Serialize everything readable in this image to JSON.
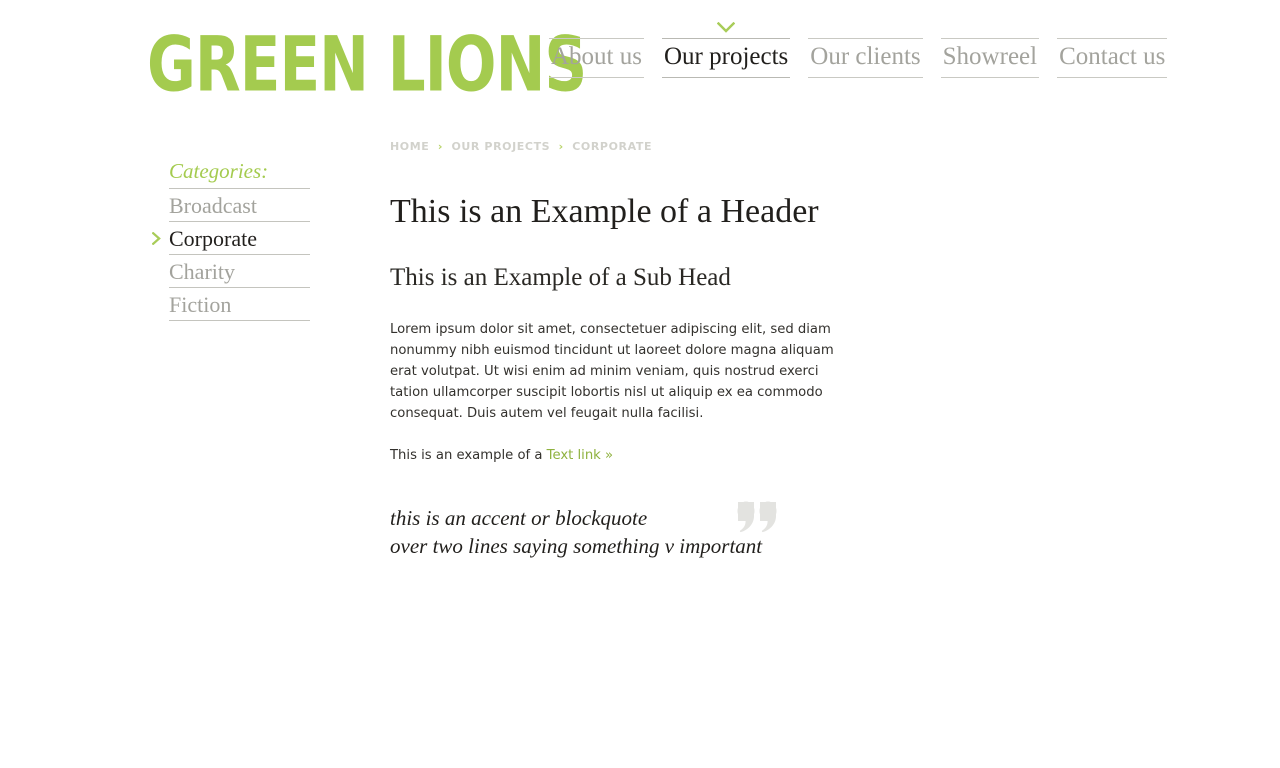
{
  "site": {
    "logo_text": "GREEN LIONS",
    "brand_green": "#a4cb4f",
    "link_green": "#8fb23f",
    "muted_gray": "#a3a39d",
    "text_dark": "#211f1c"
  },
  "nav": {
    "items": [
      {
        "label": "About us",
        "active": false
      },
      {
        "label": "Our projects",
        "active": true
      },
      {
        "label": "Our clients",
        "active": false
      },
      {
        "label": "Showreel",
        "active": false
      },
      {
        "label": "Contact us",
        "active": false
      }
    ],
    "marker_icon": "chevron-down-icon"
  },
  "sidebar": {
    "title": "Categories:",
    "items": [
      {
        "label": "Broadcast",
        "active": false
      },
      {
        "label": "Corporate",
        "active": true
      },
      {
        "label": "Charity",
        "active": false
      },
      {
        "label": "Fiction",
        "active": false
      }
    ],
    "active_marker_icon": "chevron-right-icon"
  },
  "breadcrumb": {
    "separator": "›",
    "items": [
      {
        "label": "HOME",
        "current": false
      },
      {
        "label": "OUR PROJECTS",
        "current": false
      },
      {
        "label": "CORPORATE",
        "current": true
      }
    ]
  },
  "main": {
    "title": "This is an Example of a Header",
    "sub_head": "This is an Example of a Sub Head",
    "body": "Lorem ipsum dolor sit amet, consectetuer adipiscing elit, sed diam nonummy nibh euismod tincidunt ut laoreet dolore magna aliquam erat volutpat. Ut wisi enim ad minim veniam, quis nostrud exerci tation ullamcorper suscipit lobortis nisl ut aliquip ex ea commodo consequat. Duis autem vel feugait nulla facilisi.",
    "link_lead": "This is an example of a ",
    "link_label": "Text link »",
    "blockquote": {
      "line1": "this is an accent or blockquote",
      "line2": "over two lines saying something v important",
      "mark_icon": "quotation-mark-icon"
    }
  }
}
